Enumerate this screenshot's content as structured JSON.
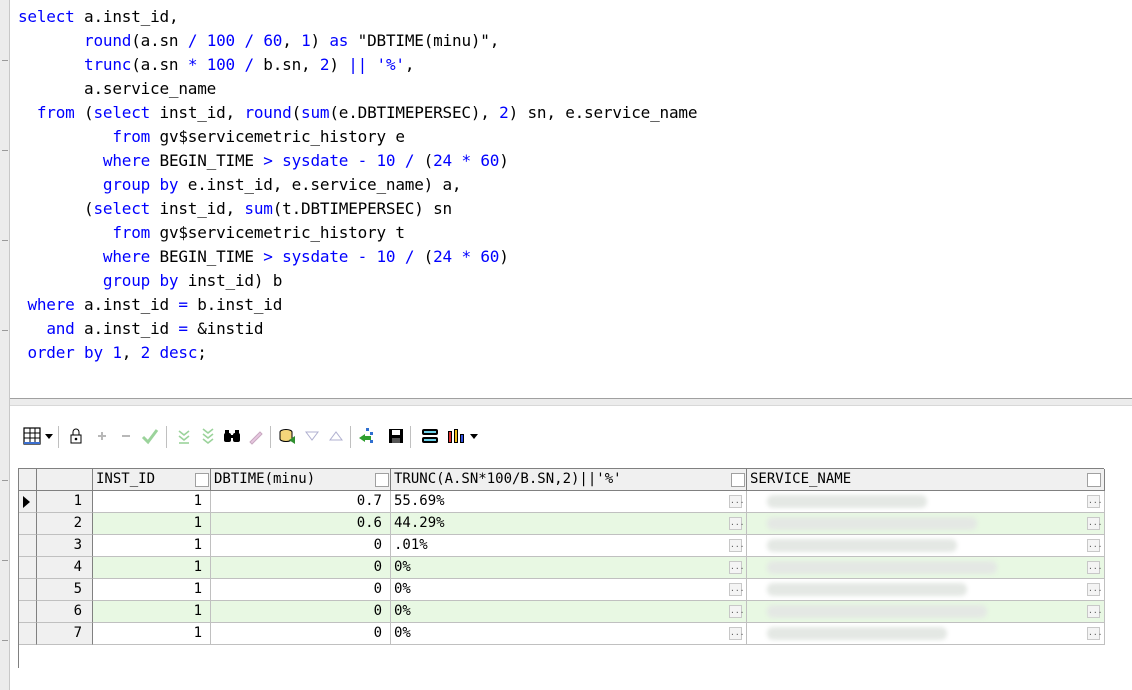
{
  "sql": {
    "lines": [
      "select a.inst_id,",
      "       round(a.sn / 100 / 60, 1) as \"DBTIME(minu)\",",
      "       trunc(a.sn * 100 / b.sn, 2) || '%',",
      "       a.service_name",
      "  from (select inst_id, round(sum(e.DBTIMEPERSEC), 2) sn, e.service_name",
      "          from gv$servicemetric_history e",
      "         where BEGIN_TIME > sysdate - 10 / (24 * 60)",
      "         group by e.inst_id, e.service_name) a,",
      "       (select inst_id, sum(t.DBTIMEPERSEC) sn",
      "          from gv$servicemetric_history t",
      "         where BEGIN_TIME > sysdate - 10 / (24 * 60)",
      "         group by inst_id) b",
      " where a.inst_id = b.inst_id",
      "   and a.inst_id = &instid",
      " order by 1, 2 desc;"
    ]
  },
  "toolbar": {
    "icons": [
      "grid-icon",
      "lock-icon",
      "plus-icon",
      "minus-icon",
      "check-icon",
      "filter-down-icon",
      "filter-down-all-icon",
      "find-icon",
      "clear-icon",
      "query-icon",
      "triangle-down-icon",
      "triangle-up-icon",
      "export-icon",
      "save-icon",
      "print-icon",
      "chart-icon"
    ]
  },
  "grid": {
    "columns": [
      "INST_ID",
      "DBTIME(minu)",
      "TRUNC(A.SN*100/B.SN,2)||'%'",
      "SERVICE_NAME"
    ],
    "rows": [
      {
        "num": "1",
        "inst_id": "1",
        "dbtime": "0.7",
        "pct": "55.69%"
      },
      {
        "num": "2",
        "inst_id": "1",
        "dbtime": "0.6",
        "pct": "44.29%"
      },
      {
        "num": "3",
        "inst_id": "1",
        "dbtime": "0",
        "pct": ".01%"
      },
      {
        "num": "4",
        "inst_id": "1",
        "dbtime": "0",
        "pct": "0%"
      },
      {
        "num": "5",
        "inst_id": "1",
        "dbtime": "0",
        "pct": "0%"
      },
      {
        "num": "6",
        "inst_id": "1",
        "dbtime": "0",
        "pct": "0%"
      },
      {
        "num": "7",
        "inst_id": "1",
        "dbtime": "0",
        "pct": "0%"
      }
    ],
    "ellipsis": "..."
  },
  "colors": {
    "keyword": "#0000ff",
    "alt_row": "#e8f8e3"
  }
}
